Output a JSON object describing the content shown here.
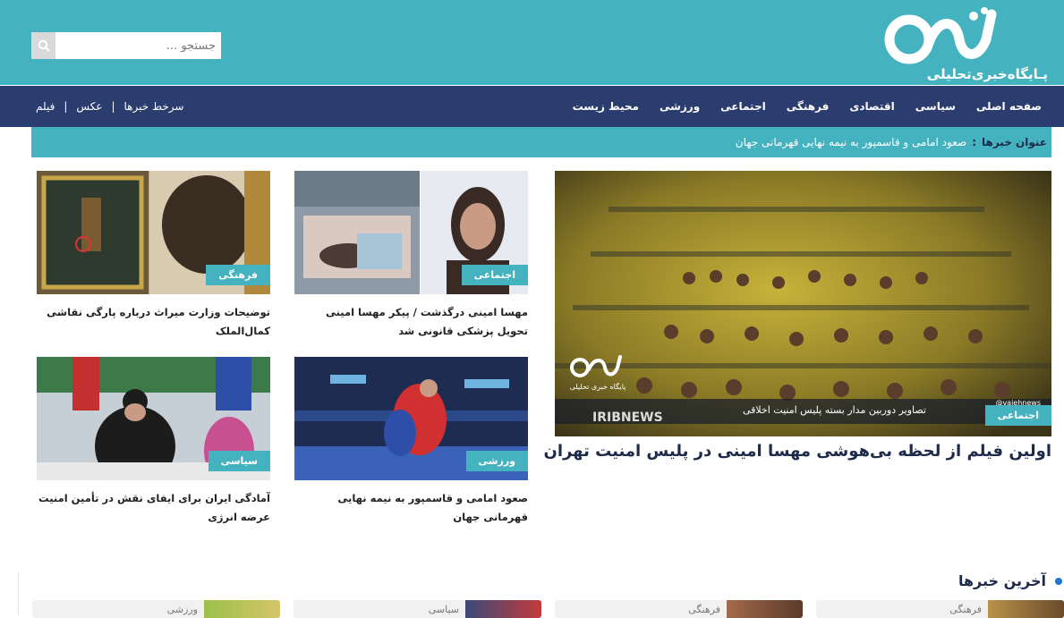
{
  "header": {
    "logo_mark": "واشه",
    "logo_tagline": "پـایگاه‌خبری‌تحلیلی",
    "search_placeholder": "جستجو ..."
  },
  "nav": {
    "items": [
      "صفحه اصلی",
      "سیاسی",
      "اقتصادی",
      "فرهنگی",
      "اجتماعی",
      "ورزشی",
      "محیط زیست"
    ],
    "left_items": [
      "سرخط خبرها",
      "عکس",
      "فیلم"
    ]
  },
  "ticker": {
    "label": "عنوان خبرها",
    "colon": ":",
    "text": "صعود امامی و قاسمپور به نیمه نهایی قهرمانی جهان"
  },
  "feature": {
    "category": "اجتماعی",
    "title": "اولین فیلم از لحظه بی‌هوشی مهسا امینی در پلیس امنیت تهران",
    "overlay_caption": "تصاویر دوربین مدار بسته  پلیس امنیت اخلاقی",
    "overlay_source": "IRIBNEWS",
    "overlay_handle": "@vajehnews",
    "watermark": "پایگاه خبری تحلیلی"
  },
  "cards": [
    {
      "category": "اجتماعی",
      "title": "مهسا امینی درگذشت / پیکر مهسا امینی تحویل پزشکی قانونی شد"
    },
    {
      "category": "فرهنگی",
      "title": "توضیحات وزارت میراث درباره پارگی نقاشی کمال‌الملک"
    },
    {
      "category": "ورزشی",
      "title": "صعود امامی و قاسمپور به نیمه نهایی قهرمانی جهان"
    },
    {
      "category": "سیاسی",
      "title": "آمادگی ایران برای ایفای نقش در تأمین امنیت عرضه انرژی"
    }
  ],
  "latest": {
    "heading": "آخرین خبرها",
    "items": [
      {
        "category": "فرهنگی"
      },
      {
        "category": "فرهنگی"
      },
      {
        "category": "سیاسی"
      },
      {
        "category": "ورزشی"
      }
    ]
  },
  "colors": {
    "teal": "#45b3bf",
    "navy": "#2b3d6e",
    "dot": "#1f74d4"
  }
}
